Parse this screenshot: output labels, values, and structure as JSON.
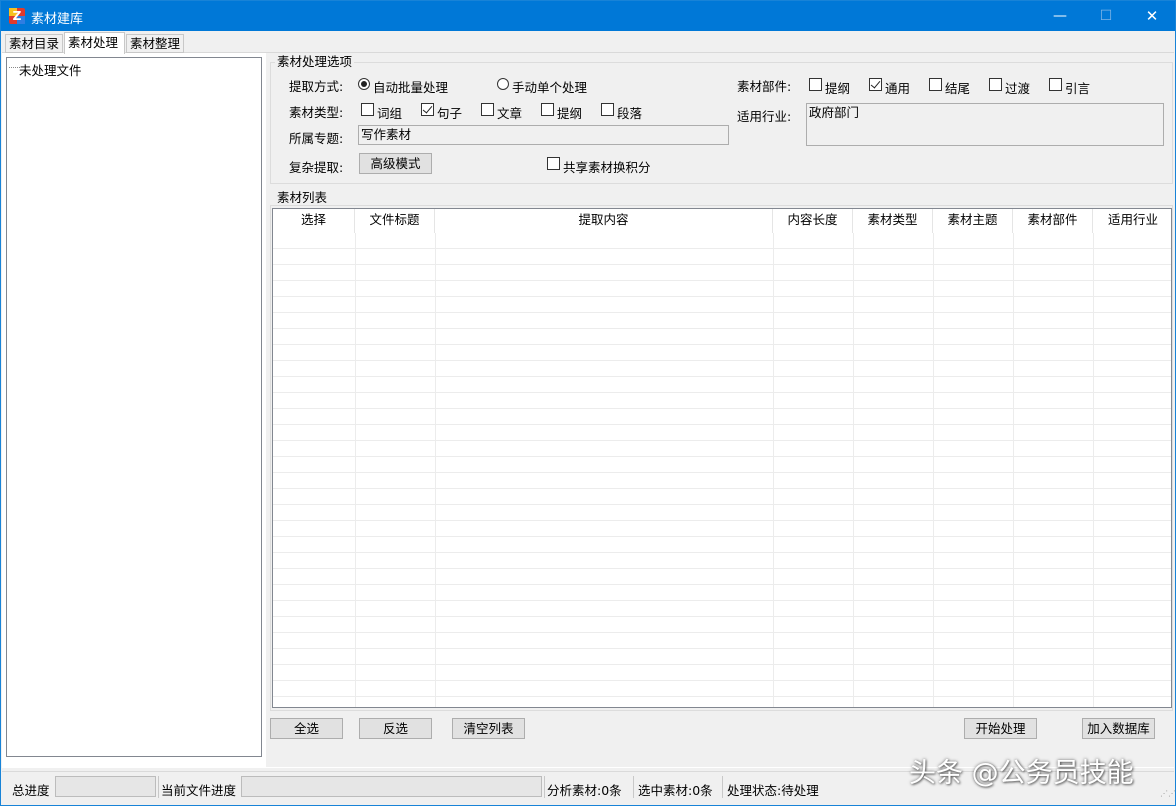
{
  "window": {
    "title": "素材建库",
    "app_icon_letter": "Z",
    "minimize": "—",
    "maximize": "☐",
    "close": "✕"
  },
  "tabs": [
    {
      "label": "素材目录",
      "active": false
    },
    {
      "label": "素材处理",
      "active": true
    },
    {
      "label": "素材整理",
      "active": false
    }
  ],
  "tree": {
    "items": [
      {
        "label": "未处理文件"
      }
    ]
  },
  "options": {
    "group_title": "素材处理选项",
    "extract_mode": {
      "label": "提取方式:",
      "choices": [
        {
          "label": "自动批量处理",
          "selected": true
        },
        {
          "label": "手动单个处理",
          "selected": false
        }
      ]
    },
    "material_type": {
      "label": "素材类型:",
      "choices": [
        {
          "label": "词组",
          "checked": false
        },
        {
          "label": "句子",
          "checked": true
        },
        {
          "label": "文章",
          "checked": false
        },
        {
          "label": "提纲",
          "checked": false
        },
        {
          "label": "段落",
          "checked": false
        }
      ]
    },
    "topic": {
      "label": "所属专题:",
      "value": "写作素材"
    },
    "complex_extract": {
      "label": "复杂提取:",
      "button": "高级模式"
    },
    "share": {
      "label": "共享素材换积分",
      "checked": false
    },
    "material_part": {
      "label": "素材部件:",
      "choices": [
        {
          "label": "提纲",
          "checked": false
        },
        {
          "label": "通用",
          "checked": true
        },
        {
          "label": "结尾",
          "checked": false
        },
        {
          "label": "过渡",
          "checked": false
        },
        {
          "label": "引言",
          "checked": false
        }
      ]
    },
    "industry": {
      "label": "适用行业:",
      "value": "政府部门"
    }
  },
  "list": {
    "group_title": "素材列表",
    "columns": [
      "选择",
      "文件标题",
      "提取内容",
      "内容长度",
      "素材类型",
      "素材主题",
      "素材部件",
      "适用行业"
    ],
    "rows": []
  },
  "buttons": {
    "select_all": "全选",
    "invert": "反选",
    "clear": "清空列表",
    "start": "开始处理",
    "add_db": "加入数据库"
  },
  "status": {
    "total_progress_label": "总进度",
    "total_progress": 0,
    "file_progress_label": "当前文件进度",
    "file_progress": 0,
    "analyzed": "分析素材:0条",
    "selected": "选中素材:0条",
    "state": "处理状态:待处理"
  },
  "watermark": "头条 @公务员技能"
}
